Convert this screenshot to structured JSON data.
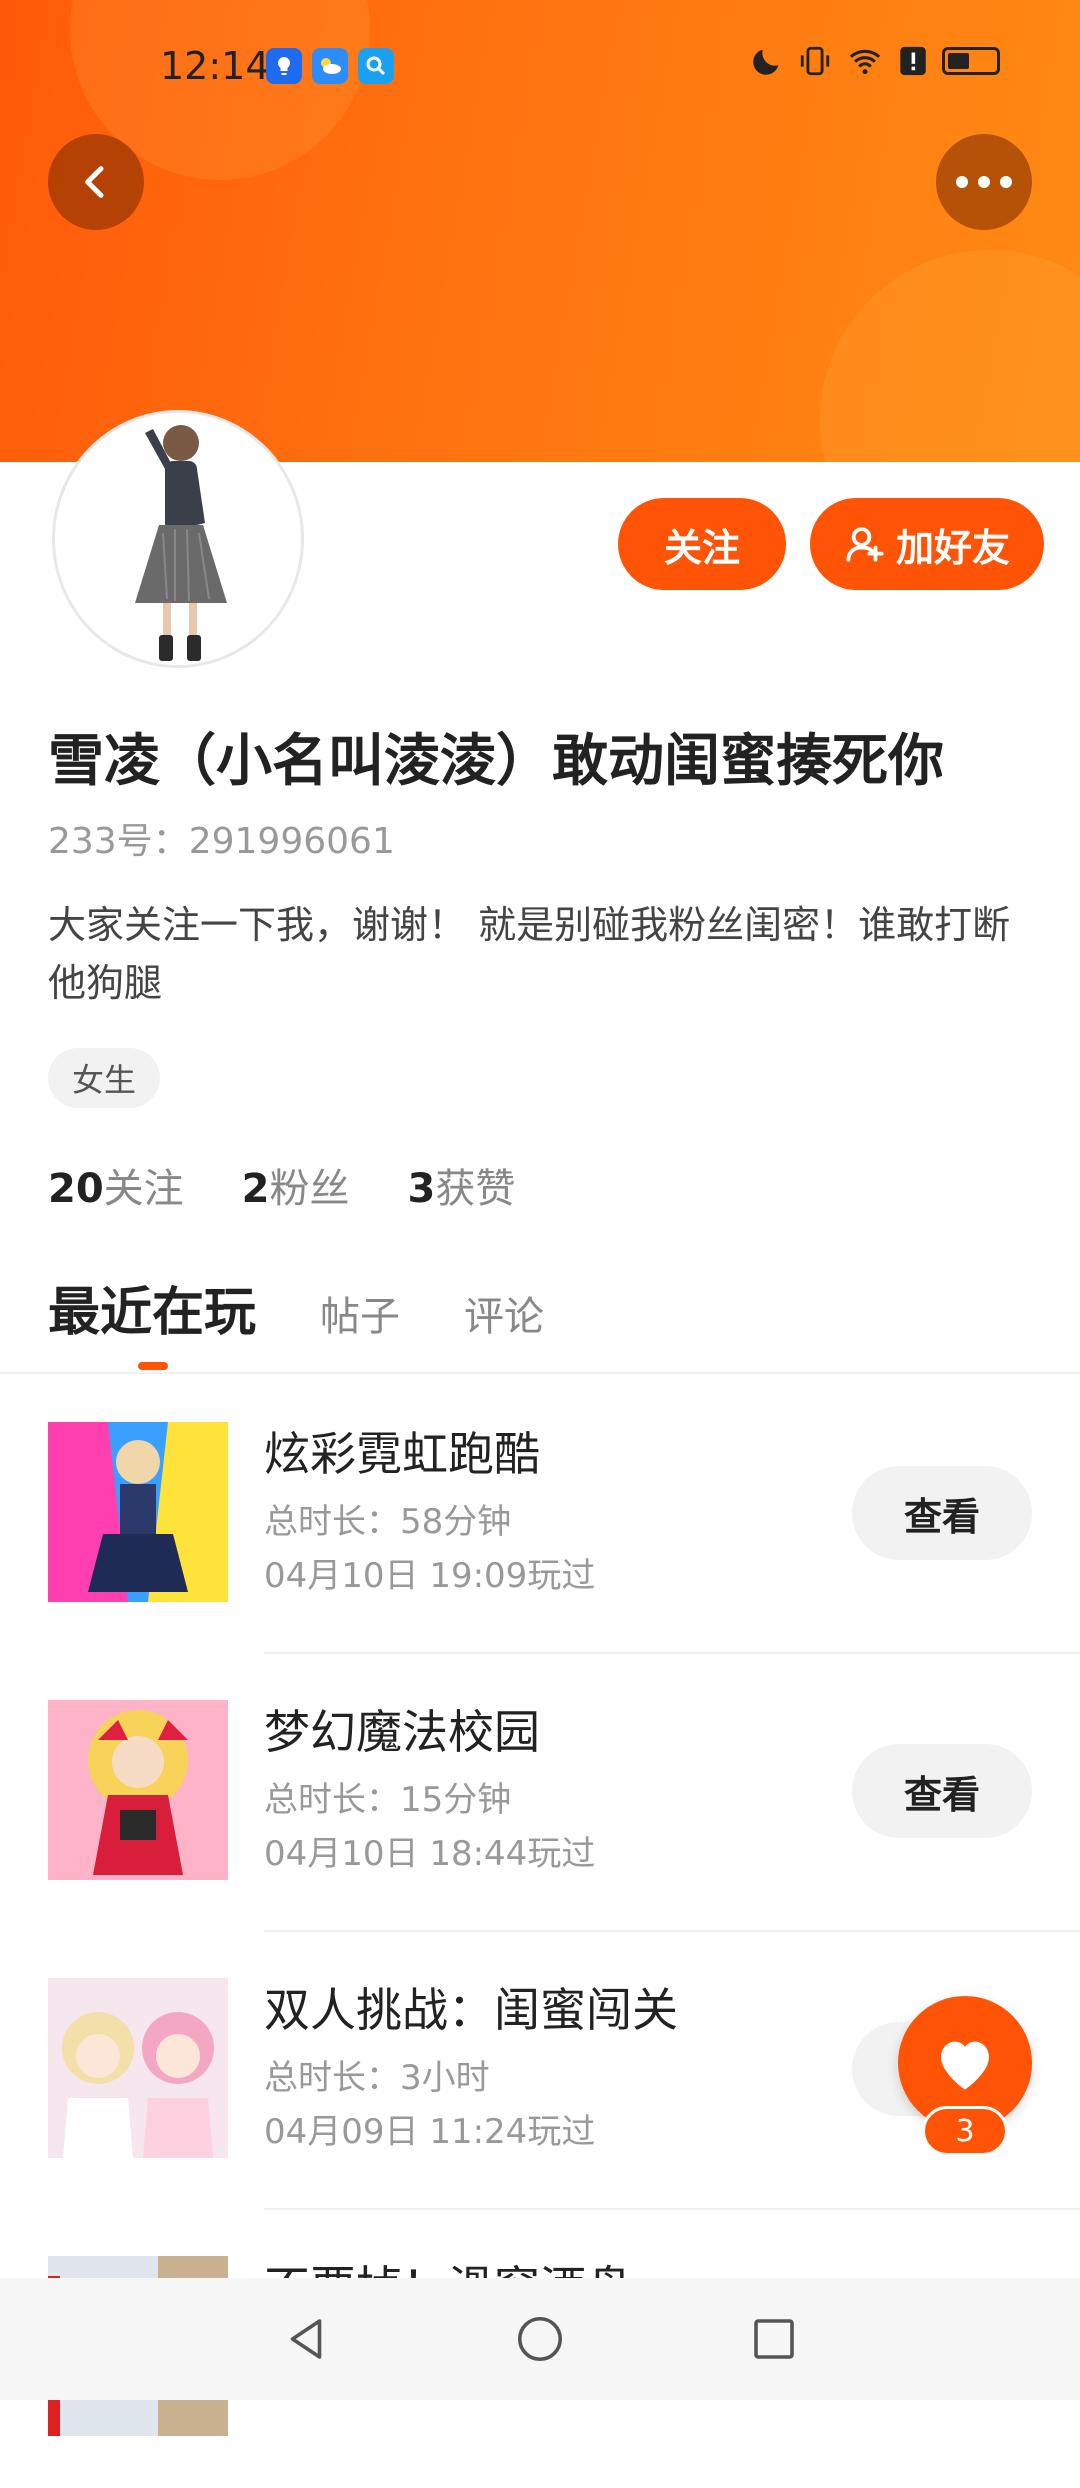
{
  "status_bar": {
    "time": "12:14",
    "notification_icons": [
      "bulb-icon",
      "weather-icon",
      "search-icon"
    ],
    "right_icons": [
      "moon-icon",
      "vibrate-icon",
      "wifi-icon",
      "alert-icon",
      "battery-icon"
    ],
    "battery_level": 0.45
  },
  "header": {
    "back_icon": "chevron-left-icon",
    "more_icon": "more-horizontal-icon",
    "follow_label": "关注",
    "add_friend_label": "加好友",
    "add_friend_icon": "user-plus-icon",
    "accent_color": "#ff5405"
  },
  "profile": {
    "name": "雪凌（小名叫淩淩）敢动闺蜜揍死你",
    "id_text": "233号：291996061",
    "bio": "大家关注一下我，谢谢！ 就是别碰我粉丝闺密！谁敢打断他狗腿",
    "tag": "女生",
    "stats": [
      {
        "num": "20",
        "label": "关注"
      },
      {
        "num": "2",
        "label": "粉丝"
      },
      {
        "num": "3",
        "label": "获赞"
      }
    ]
  },
  "tabs": [
    {
      "label": "最近在玩",
      "active": true
    },
    {
      "label": "帖子",
      "active": false
    },
    {
      "label": "评论",
      "active": false
    }
  ],
  "games": [
    {
      "title": "炫彩霓虹跑酷",
      "duration": "总时长：58分钟",
      "played": "04月10日 19:09玩过",
      "button": "查看"
    },
    {
      "title": "梦幻魔法校园",
      "duration": "总时长：15分钟",
      "played": "04月10日 18:44玩过",
      "button": "查看"
    },
    {
      "title": "双人挑战：闺蜜闯关",
      "duration": "总时长：3小时",
      "played": "04月09日 11:24玩过",
      "button": "查看"
    },
    {
      "title": "不要掉！滑窗酒盘",
      "duration": "",
      "played": "",
      "button": ""
    }
  ],
  "like_fab": {
    "icon": "heart-icon",
    "count": "3"
  },
  "nav_bar": {
    "icons": [
      "nav-back-icon",
      "nav-home-icon",
      "nav-recents-icon"
    ]
  }
}
